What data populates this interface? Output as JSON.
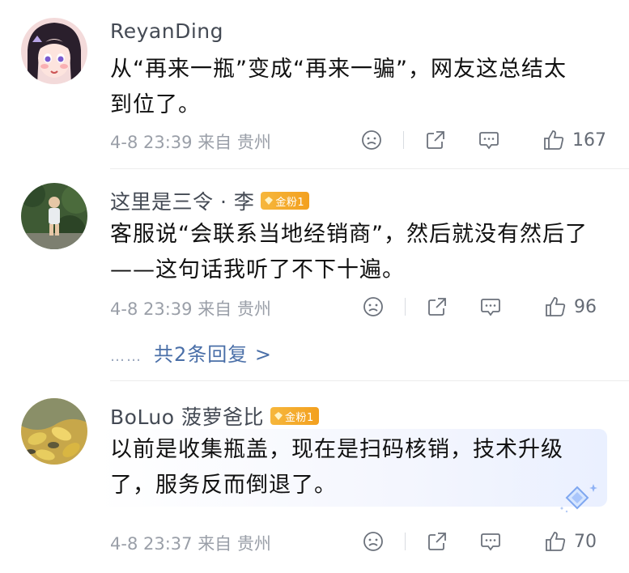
{
  "comments": [
    {
      "username": "ReyanDing",
      "badge": "",
      "text": "从“再来一瓶”变成“再来一骗”，网友这总结太到位了。",
      "line1": "从“再来一瓶”变成“再来一骗”，网友这总结太",
      "line2": "到位了。",
      "time": "4-8 23:39",
      "location": "来自 贵州",
      "likes": "167"
    },
    {
      "username": "这里是三令 · 李",
      "badge": "金粉1",
      "line1": "客服说“会联系当地经销商”，然后就没有然后了",
      "line2": "——这句话我听了不下十遍。",
      "time": "4-8 23:39",
      "location": "来自 贵州",
      "likes": "96",
      "replies_link": "共2条回复 >"
    },
    {
      "username": "BoLuo 菠萝爸比",
      "badge": "金粉1",
      "line1": "以前是收集瓶盖，现在是扫码核销，技术升级",
      "line2": "了，服务反而倒退了。",
      "time": "4-8 23:37",
      "location": "来自 贵州",
      "likes": "70"
    }
  ],
  "replies_dots": "……",
  "icons": [
    "frown-icon",
    "share-icon",
    "comment-icon",
    "thumbs-up-icon",
    "gem-icon",
    "sparkle-icon"
  ],
  "colors": {
    "badge": "#f3a01f",
    "link": "#4a6fa8",
    "meta": "#9a9fa8"
  }
}
